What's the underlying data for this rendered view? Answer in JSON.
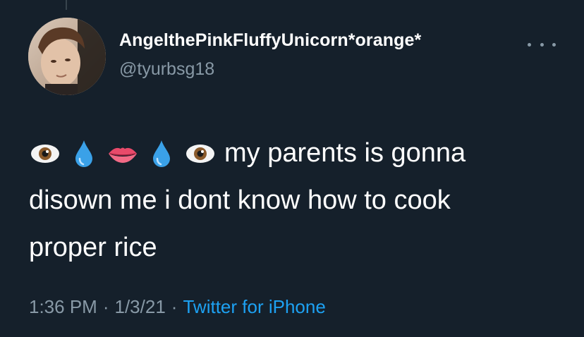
{
  "user": {
    "display_name": "AngelthePinkFluffyUnicorn*orange*",
    "handle": "@tyurbsg18",
    "avatar_icon": "profile-photo"
  },
  "tweet": {
    "emojis": [
      "eye-icon",
      "droplet-icon",
      "lips-icon",
      "droplet-icon",
      "eye-icon"
    ],
    "line1_text": "my parents is gonna",
    "line2_text": "disown me i dont know how to cook",
    "line3_text": "proper rice"
  },
  "meta": {
    "time": "1:36 PM",
    "separator": "·",
    "date": "1/3/21",
    "source": "Twitter for iPhone"
  },
  "colors": {
    "background": "#15202b",
    "primary_text": "#ffffff",
    "secondary_text": "#8899a6",
    "link": "#1da1f2"
  }
}
